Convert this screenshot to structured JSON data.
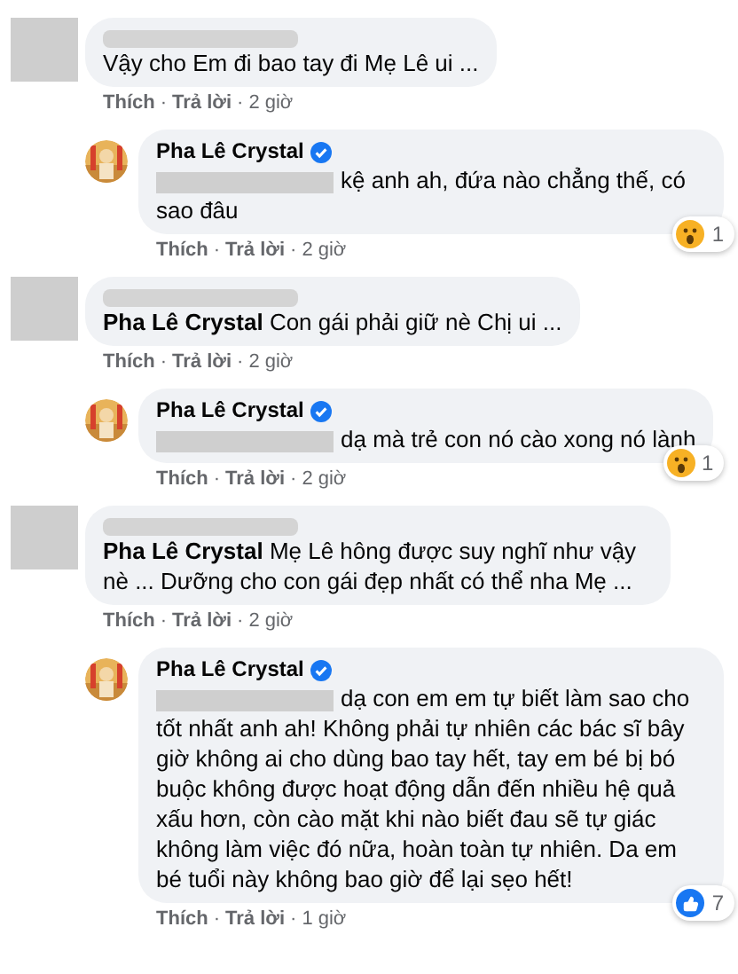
{
  "comments": [
    {
      "kind": "comment",
      "name_redacted": true,
      "text": "Vậy cho Em đi bao tay đi Mẹ Lê ui ...",
      "meta": {
        "like": "Thích",
        "reply": "Trả lời",
        "time": "2 giờ",
        "separator": "·"
      }
    },
    {
      "kind": "reply",
      "author": "Pha Lê Crystal",
      "verified": true,
      "text": "kệ anh ah, đứa nào chẳng thế, có sao đâu",
      "text_redacted_prefix": true,
      "reaction": {
        "kind": "wow",
        "count": "1"
      },
      "meta": {
        "like": "Thích",
        "reply": "Trả lời",
        "time": "2 giờ",
        "separator": "·"
      }
    },
    {
      "kind": "comment",
      "name_redacted": true,
      "text": "**Pha Lê Crystal** Con gái phải giữ nè Chị ui ...",
      "meta": {
        "like": "Thích",
        "reply": "Trả lời",
        "time": "2 giờ",
        "separator": "·"
      }
    },
    {
      "kind": "reply",
      "author": "Pha Lê Crystal",
      "verified": true,
      "text": "dạ mà trẻ con nó cào xong nó lành",
      "text_redacted_prefix": true,
      "reaction": {
        "kind": "wow",
        "count": "1"
      },
      "meta": {
        "like": "Thích",
        "reply": "Trả lời",
        "time": "2 giờ",
        "separator": "·"
      }
    },
    {
      "kind": "comment",
      "name_redacted": true,
      "text": "**Pha Lê Crystal** Mẹ Lê hông được suy nghĩ như vậy nè ... Dưỡng cho con gái đẹp nhất có thể nha Mẹ ...",
      "meta": {
        "like": "Thích",
        "reply": "Trả lời",
        "time": "2 giờ",
        "separator": "·"
      }
    },
    {
      "kind": "reply",
      "author": "Pha Lê Crystal",
      "verified": true,
      "text": "dạ con em em tự biết làm sao cho tốt nhất anh ah! Không phải tự nhiên các bác sĩ bây giờ không ai cho dùng bao tay hết, tay em bé bị bó buộc không được hoạt động dẫn đến nhiều hệ quả xấu hơn, còn cào mặt khi nào biết đau sẽ tự giác không làm việc đó nữa, hoàn toàn tự nhiên. Da em bé tuổi này không bao giờ để lại sẹo hết!",
      "text_redacted_prefix": true,
      "reaction": {
        "kind": "like",
        "count": "7"
      },
      "meta": {
        "like": "Thích",
        "reply": "Trả lời",
        "time": "1 giờ",
        "separator": "·"
      }
    }
  ]
}
